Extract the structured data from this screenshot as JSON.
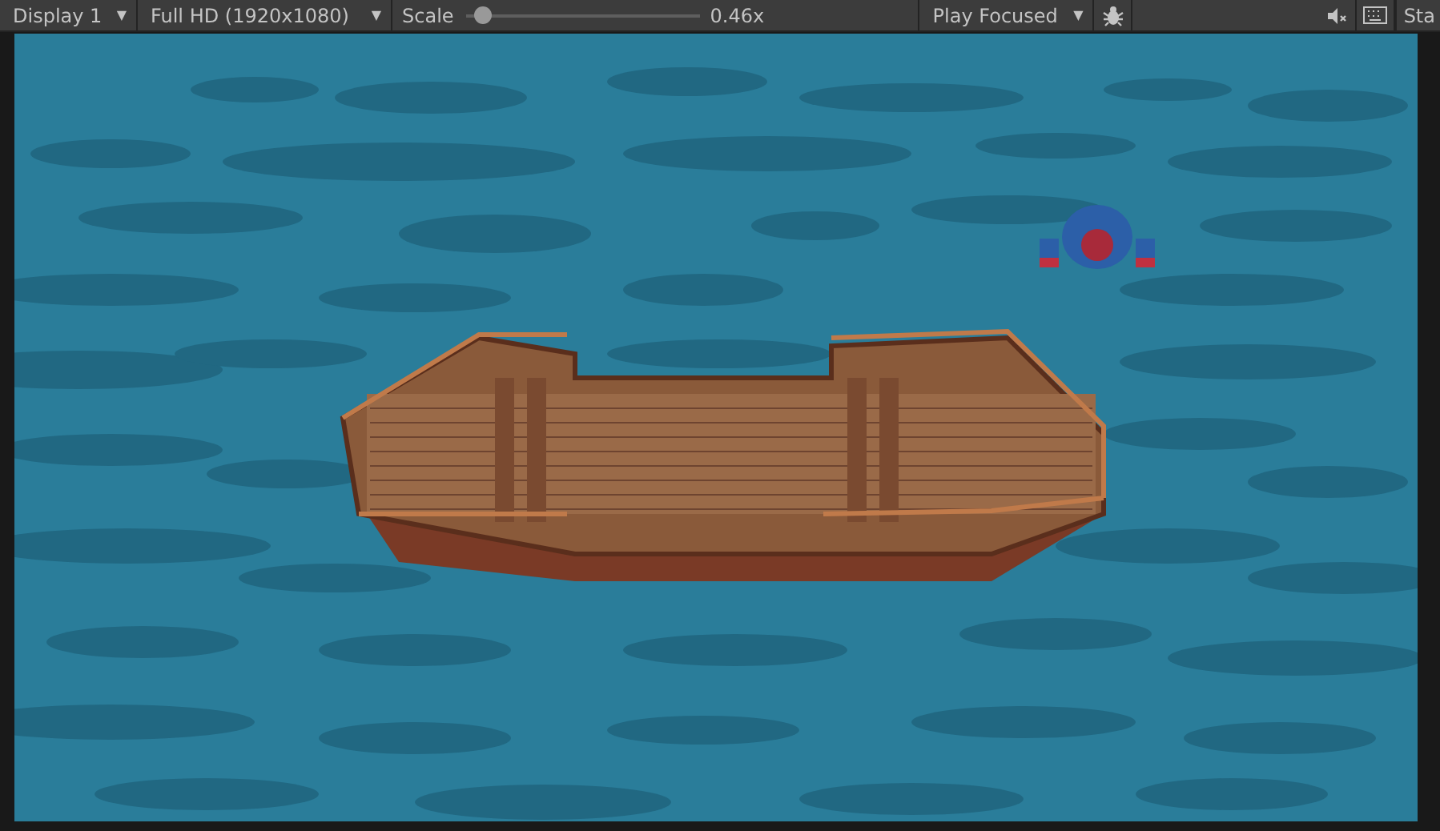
{
  "toolbar": {
    "display": {
      "label": "Display 1",
      "caret": "▼"
    },
    "resolution": {
      "label": "Full HD (1920x1080)",
      "caret": "▼"
    },
    "scale": {
      "label": "Scale",
      "level": 0.03,
      "reading": "0.46x"
    },
    "play_mode": {
      "label": "Play Focused",
      "caret": "▼"
    },
    "mute_audio": {
      "on": false
    },
    "stats": {
      "label": "Sta"
    }
  }
}
